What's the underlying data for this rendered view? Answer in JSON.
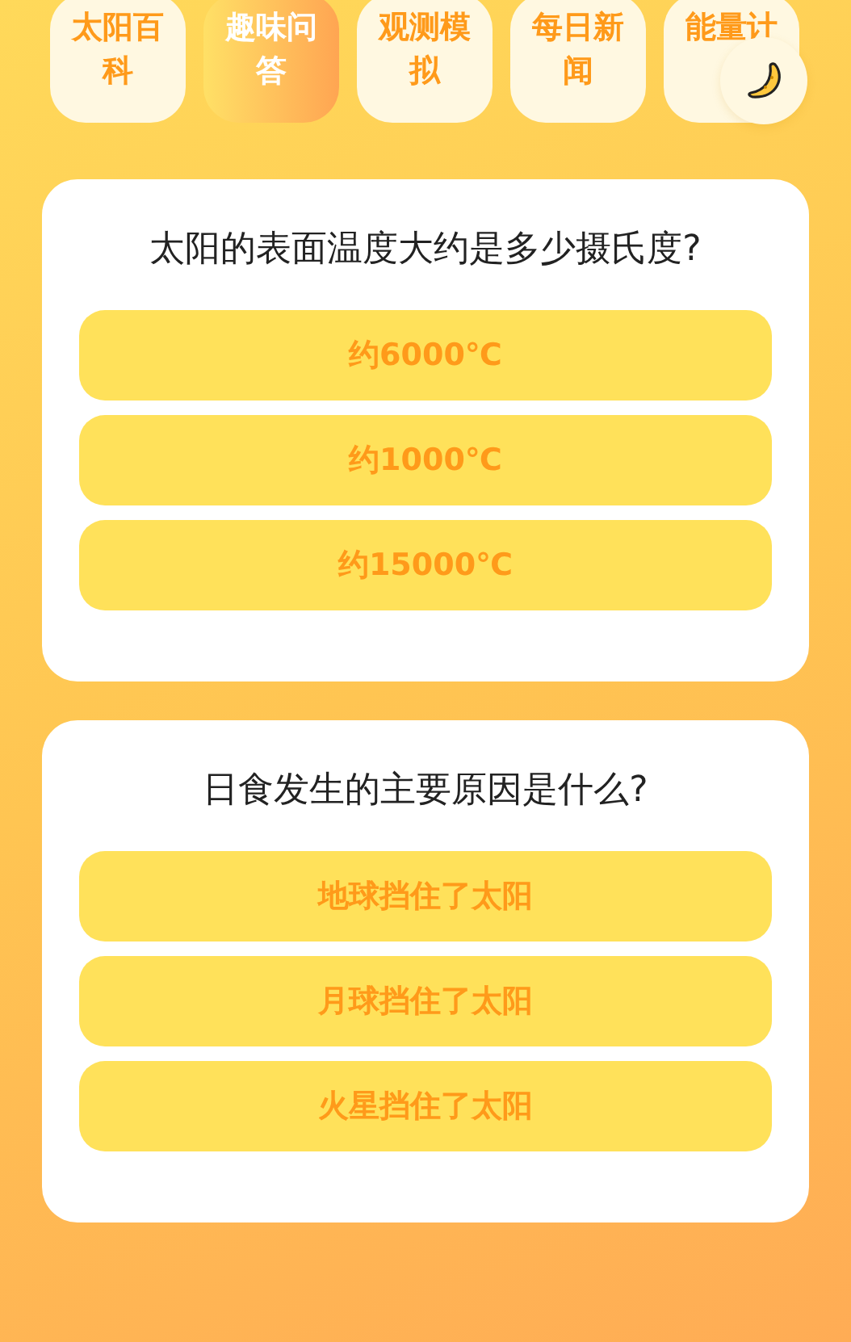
{
  "tabs": [
    {
      "label": "太阳百科",
      "selected": false
    },
    {
      "label": "趣味问答",
      "selected": true
    },
    {
      "label": "观测模拟",
      "selected": false
    },
    {
      "label": "每日新闻",
      "selected": false
    },
    {
      "label": "能量计",
      "selected": false
    }
  ],
  "theme_toggle": {
    "kind": "moon"
  },
  "questions": [
    {
      "question": "太阳的表面温度大约是多少摄氏度?",
      "options": [
        "约6000℃",
        "约1000℃",
        "约15000℃"
      ]
    },
    {
      "question": "日食发生的主要原因是什么?",
      "options": [
        "地球挡住了太阳",
        "月球挡住了太阳",
        "火星挡住了太阳"
      ]
    }
  ]
}
